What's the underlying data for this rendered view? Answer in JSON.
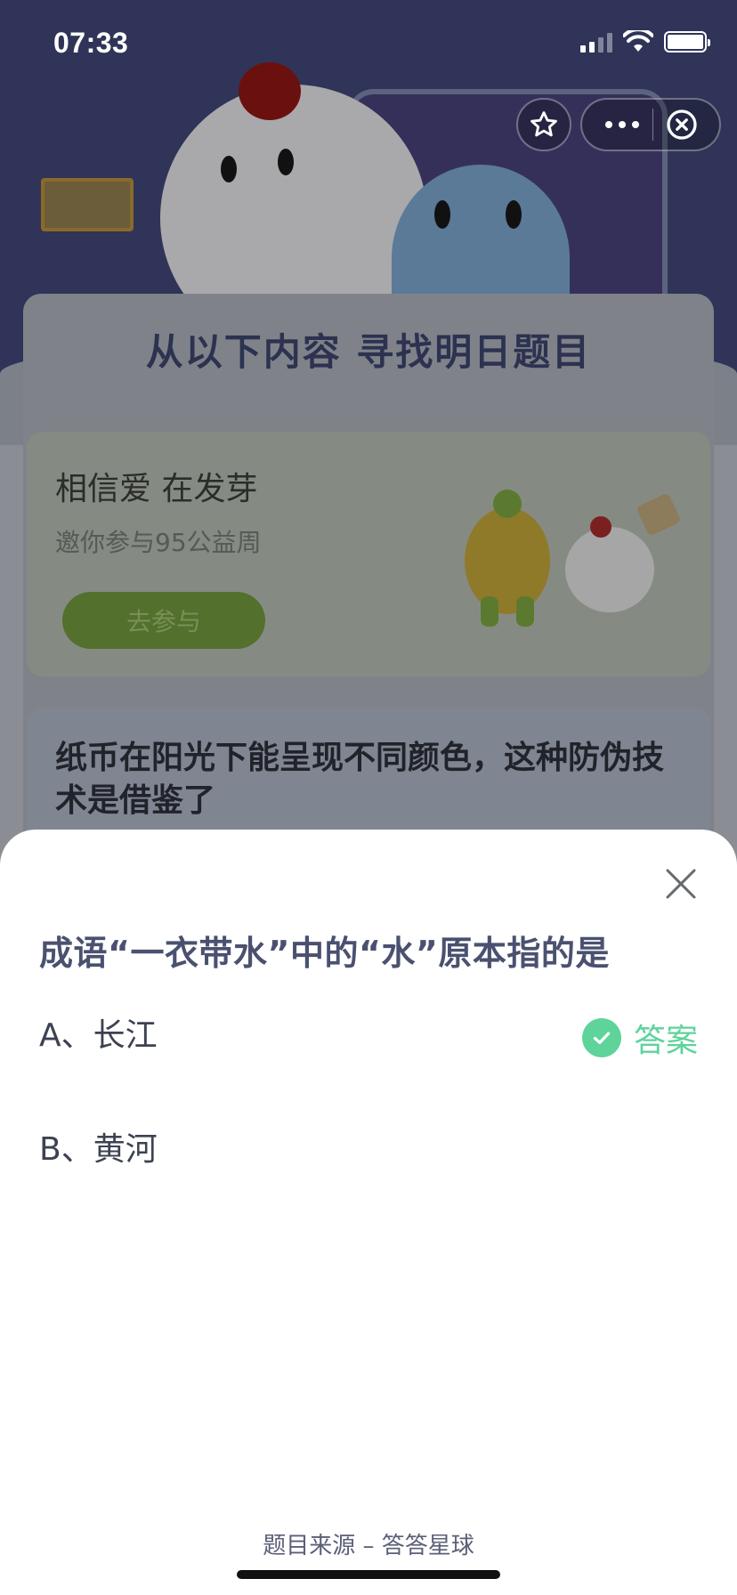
{
  "status_bar": {
    "time": "07:33"
  },
  "mini_program_capsule": {
    "star_icon": "star-outline-icon",
    "more_icon": "more-dots-icon",
    "close_icon": "close-circle-icon"
  },
  "background_page": {
    "section_title": "从以下内容  寻找明日题目",
    "promo": {
      "title": "相信爱  在发芽",
      "subtitle": "邀你参与95公益周",
      "button_label": "去参与"
    },
    "question_preview": "纸币在阳光下能呈现不同颜色，这种防伪技术是借鉴了"
  },
  "sheet": {
    "question": "成语“一衣带水”中的“水”原本指的是",
    "options": [
      {
        "label": "A、长江"
      },
      {
        "label": "B、黄河"
      }
    ],
    "answer_label": "答案",
    "answer_icon": "check-circle-icon",
    "close_icon": "close-x-icon",
    "source": "题目来源 – 答答星球"
  },
  "colors": {
    "accent_green": "#5ed39a",
    "question_text": "#4a5170",
    "overlay_dim": "#808080"
  }
}
